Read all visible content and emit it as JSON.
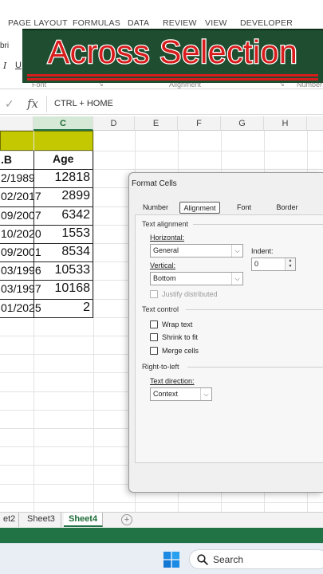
{
  "ribbon": {
    "tabs": [
      "PAGE LAYOUT",
      "FORMULAS",
      "DATA",
      "REVIEW",
      "VIEW",
      "DEVELOPER"
    ],
    "font_name": "bri",
    "italic": "I",
    "underline": "U",
    "groups": [
      "Font",
      "Alignment",
      "Number"
    ]
  },
  "banner": {
    "text": "Across Selection"
  },
  "formula_bar": {
    "check": "✓",
    "fx": "fx",
    "content": "CTRL + HOME"
  },
  "columns": [
    "C",
    "D",
    "E",
    "F",
    "G",
    "H"
  ],
  "table": {
    "headers": [
      ".B",
      "Age"
    ],
    "rows": [
      [
        "2/1989",
        "12818"
      ],
      [
        "02/2017",
        "2899"
      ],
      [
        "09/2007",
        "6342"
      ],
      [
        "10/2020",
        "1553"
      ],
      [
        "09/2001",
        "8534"
      ],
      [
        "03/1996",
        "10533"
      ],
      [
        "03/1997",
        "10168"
      ],
      [
        "01/2025",
        "2"
      ]
    ]
  },
  "dialog": {
    "title": "Format Cells",
    "tabs": [
      "Number",
      "Alignment",
      "Font",
      "Border"
    ],
    "text_alignment": "Text alignment",
    "horizontal_label": "Horizontal:",
    "horizontal_value": "General",
    "vertical_label": "Vertical:",
    "vertical_value": "Bottom",
    "indent_label": "Indent:",
    "indent_value": "0",
    "justify_distributed": "Justify distributed",
    "text_control": "Text control",
    "wrap_text": "Wrap text",
    "shrink_to_fit": "Shrink to fit",
    "merge_cells": "Merge cells",
    "right_to_left": "Right-to-left",
    "text_direction_label": "Text direction:",
    "text_direction_value": "Context"
  },
  "sheets": [
    "et2",
    "Sheet3",
    "Sheet4"
  ],
  "add_sheet": "+",
  "taskbar": {
    "search_placeholder": "Search"
  },
  "colors": {
    "excel_green": "#217346",
    "banner_bg": "#1e4d2f",
    "banner_text": "#d81c1c",
    "highlight": "#c4c800"
  }
}
